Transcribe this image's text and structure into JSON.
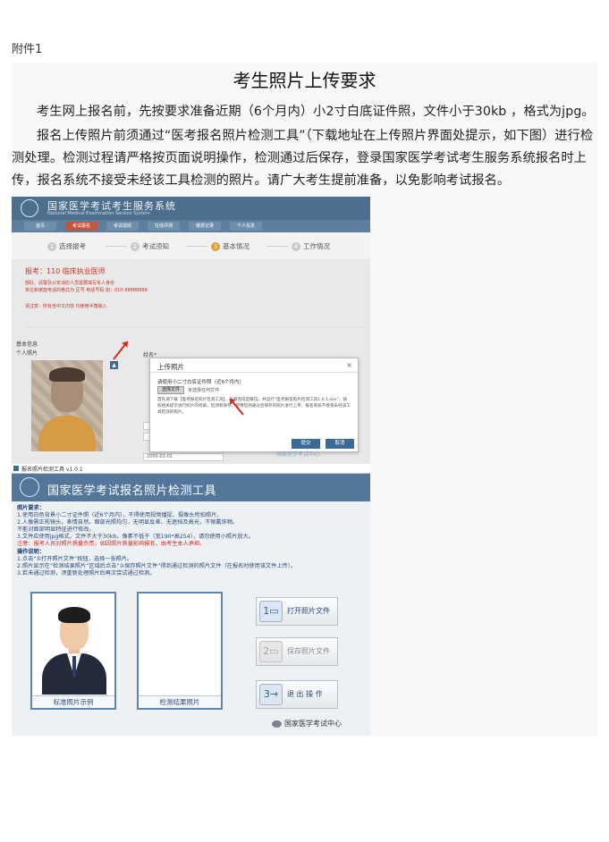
{
  "attachment_label": "附件1",
  "title": "考生照片上传要求",
  "paragraph1": "考生网上报名前，先按要求准备近期（6个月内）小2寸白底证件照，文件小于30kb ，格式为jpg。",
  "paragraph2": "报名上传照片前须通过“医考报名照片检测工具”（下载地址在上传照片界面处提示，如下图）进行检测处理。检测过程请严格按页面说明操作，检测通过后保存，登录国家医学考试考生服务系统报名时上传，报名系统不接受未经该工具检测的照片。请广大考生提前准备，以免影响考试报名。",
  "screenshot1": {
    "system_title": "国家医学考试考生服务系统",
    "system_subtitle": "National Medical Examination Service System",
    "nav": [
      "首页",
      "考试报名",
      "考试成绩",
      "在线评测",
      "缴费记录",
      "个人信息"
    ],
    "steps": [
      {
        "num": "1",
        "label": "选择报考"
      },
      {
        "num": "2",
        "label": "考试须知"
      },
      {
        "num": "3",
        "label": "基本情况"
      },
      {
        "num": "4",
        "label": "工作情况"
      }
    ],
    "exam": "报考：110 临床执业医师",
    "note1": "部队、武警及公安消防人员需要填写本人身份",
    "note2": "单位和家庭电话的格式为 区号-电话号码 如：010-88888888",
    "note3": "请注意：所有含中文内容 均使用半角输入",
    "section": "基本信息",
    "photo_label": "个人照片",
    "name_label": "姓名*",
    "date_value": "2000-01-01",
    "dialog": {
      "title": "上传照片",
      "close": "×",
      "line1": "请使用小二寸白底证件照（近6个月内）",
      "file_button": "选择文件",
      "file_status": "未选择任何文件",
      "desc": "首先请下载【医考报名照片检测工具】，下载完成后解压，并运行“医考报名照片检测工具1.0.1.exe”，按照相关提示进行照片的修裁，检测和保存。使用检测通过后保存的照片进行上传，报名系统不接受未经该工具检测的照片。",
      "ok": "提交",
      "cancel": "取消"
    },
    "watermark": "国家医学考试中心"
  },
  "screenshot2": {
    "window_title": "报名照片检测工具 v1.0.1",
    "title": "国家医学考试报名照片检测工具",
    "lines": [
      "照片要求：",
      "1.使用白色背景小二寸证件照（近6个月内），不得使用视频播捉、摄像头所拍照片。",
      "2.人像需正视镜头，表情自然。面部光照均匀，无明显反差、无遮挡及高光，不佩戴饰物。",
      "不能对面部明显特征进行修改。",
      "3.文件应使用jpg格式，文件不大于30kb，像素不低于（宽190*高254），请勿使用小照片放大。",
      "注意：报考人员对照片质量负责，如因照片质量影响报名，由考生本人承担。",
      "操作说明：",
      "1.点击“①打开照片文件”按钮，选择一张照片。",
      "2.照片显示在“检测结果照片”区域后点击“②保存照片文件”得到通过检测的照片文件（在报名时使用该文件上传）。",
      "3.若未通过检测，须重新处理照片后再次尝试通过检测。"
    ],
    "sample_caption": "标准照片示例",
    "result_caption": "检测结果照片",
    "buttons": [
      {
        "icon": "open-folder",
        "label": "打开照片文件"
      },
      {
        "icon": "save-file",
        "label": "保存照片文件"
      },
      {
        "icon": "exit",
        "label": "退 出 操 作"
      }
    ],
    "footer": "国家医学考试中心"
  },
  "colors": {
    "banner": "#4d6f8e",
    "tool_banner": "#53779a",
    "alert_red": "#d62b1f",
    "active_tab": "#c0573f"
  }
}
